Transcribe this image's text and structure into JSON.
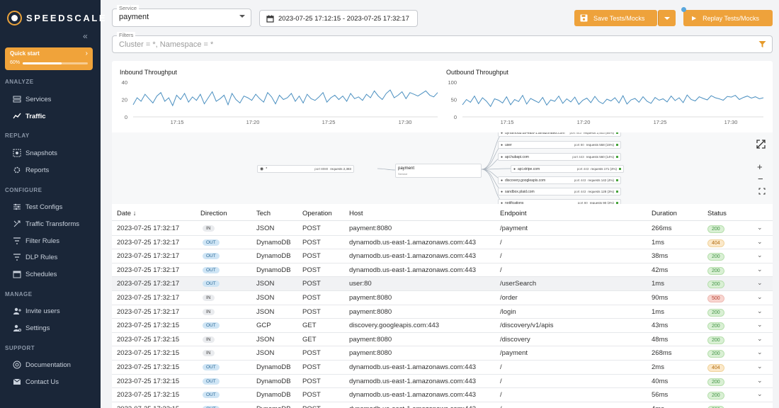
{
  "brand": {
    "name": "SPEEDSCALE"
  },
  "quick_start": {
    "label": "Quick start",
    "percent_text": "60%",
    "progress": 0.6
  },
  "sidebar": {
    "sections": [
      {
        "title": "ANALYZE",
        "items": [
          {
            "label": "Services",
            "icon": "services-icon"
          },
          {
            "label": "Traffic",
            "icon": "traffic-icon",
            "active": true
          }
        ]
      },
      {
        "title": "REPLAY",
        "items": [
          {
            "label": "Snapshots",
            "icon": "snapshots-icon"
          },
          {
            "label": "Reports",
            "icon": "reports-icon"
          }
        ]
      },
      {
        "title": "CONFIGURE",
        "items": [
          {
            "label": "Test Configs",
            "icon": "test-configs-icon"
          },
          {
            "label": "Traffic Transforms",
            "icon": "transforms-icon"
          },
          {
            "label": "Filter Rules",
            "icon": "filter-icon"
          },
          {
            "label": "DLP Rules",
            "icon": "dlp-icon"
          },
          {
            "label": "Schedules",
            "icon": "calendar-icon"
          }
        ]
      },
      {
        "title": "MANAGE",
        "items": [
          {
            "label": "Invite users",
            "icon": "invite-users-icon"
          },
          {
            "label": "Settings",
            "icon": "settings-icon"
          }
        ]
      },
      {
        "title": "SUPPORT",
        "items": [
          {
            "label": "Documentation",
            "icon": "documentation-icon"
          },
          {
            "label": "Contact Us",
            "icon": "contact-icon"
          }
        ]
      }
    ]
  },
  "toolbar": {
    "service_label": "Service",
    "service_value": "payment",
    "date_range": "2023-07-25 17:12:15 - 2023-07-25 17:32:17",
    "save_label": "Save Tests/Mocks",
    "replay_label": "Replay Tests/Mocks"
  },
  "filters": {
    "label": "Filters",
    "placeholder": "Cluster = *, Namespace = *"
  },
  "charts": {
    "inbound": {
      "title": "Inbound Throughput",
      "yticks": [
        "40",
        "20",
        "0"
      ],
      "xticks": [
        "17:15",
        "17:20",
        "17:25",
        "17:30"
      ]
    },
    "outbound": {
      "title": "Outbound Throughput",
      "yticks": [
        "100",
        "50",
        "0"
      ],
      "xticks": [
        "17:15",
        "17:20",
        "17:25",
        "17:30"
      ]
    }
  },
  "chart_data": [
    {
      "type": "line",
      "title": "Inbound Throughput",
      "ylim": [
        0,
        40
      ],
      "xlim": [
        "17:12",
        "17:32"
      ],
      "series": [
        {
          "values": [
            14,
            22,
            18,
            26,
            21,
            16,
            24,
            28,
            18,
            22,
            13,
            25,
            20,
            27,
            17,
            23,
            19,
            26,
            15,
            22,
            29,
            18,
            21,
            25,
            14,
            27,
            20,
            16,
            24,
            22,
            19,
            26,
            21,
            17,
            28,
            23,
            15,
            25,
            20,
            22,
            27,
            18,
            24,
            16,
            26,
            21,
            19,
            23,
            28,
            17,
            22,
            25,
            20,
            24,
            18,
            27,
            21,
            23,
            19,
            26,
            22,
            30,
            24,
            20,
            27,
            31,
            22,
            25,
            29,
            21,
            28,
            26,
            24,
            27,
            30,
            25,
            23,
            28
          ]
        }
      ]
    },
    {
      "type": "line",
      "title": "Outbound Throughput",
      "ylim": [
        0,
        100
      ],
      "xlim": [
        "17:12",
        "17:32"
      ],
      "series": [
        {
          "values": [
            35,
            50,
            42,
            60,
            38,
            55,
            45,
            30,
            52,
            48,
            40,
            58,
            35,
            50,
            44,
            62,
            37,
            53,
            47,
            41,
            56,
            34,
            49,
            45,
            60,
            39,
            52,
            43,
            57,
            36,
            48,
            54,
            41,
            59,
            44,
            38,
            51,
            46,
            55,
            40,
            61,
            37,
            49,
            53,
            42,
            58,
            45,
            39,
            56,
            48,
            52,
            43,
            60,
            47,
            55,
            41,
            63,
            50,
            46,
            58,
            53,
            49,
            61,
            55,
            52,
            48,
            59,
            57,
            62,
            50,
            56,
            60,
            54,
            58,
            52,
            55
          ]
        }
      ]
    }
  ],
  "graph": {
    "source": {
      "name": "*",
      "port_text": "port 8080",
      "requests_text": "requests 2,383"
    },
    "service": {
      "name": "payment",
      "sub": "Service"
    },
    "targets": [
      {
        "name": "dynamodb.us-east-1.amazonaws.com",
        "port": "443",
        "req": "2,403 (84%)"
      },
      {
        "name": "user",
        "port": "80",
        "req": "558 (15%)"
      },
      {
        "name": "api.hubapi.com",
        "port": "443",
        "req": "560 (14%)"
      },
      {
        "name": "api.stripe.com",
        "port": "443",
        "req": "171 (4%)"
      },
      {
        "name": "discovery.googleapis.com",
        "port": "443",
        "req": "142 (4%)"
      },
      {
        "name": "sandbox.plaid.com",
        "port": "443",
        "req": "128 (3%)"
      },
      {
        "name": "notifications",
        "port": "80",
        "req": "90 (2%)"
      }
    ]
  },
  "table": {
    "columns": [
      "Date",
      "Direction",
      "Tech",
      "Operation",
      "Host",
      "Endpoint",
      "Duration",
      "Status"
    ],
    "rows": [
      {
        "date": "2023-07-25 17:32:17",
        "dir": "IN",
        "tech": "JSON",
        "op": "POST",
        "host": "payment:8080",
        "endpoint": "/payment",
        "duration": "266ms",
        "status": "200"
      },
      {
        "date": "2023-07-25 17:32:17",
        "dir": "OUT",
        "tech": "DynamoDB",
        "op": "POST",
        "host": "dynamodb.us-east-1.amazonaws.com:443",
        "endpoint": "/",
        "duration": "1ms",
        "status": "404"
      },
      {
        "date": "2023-07-25 17:32:17",
        "dir": "OUT",
        "tech": "DynamoDB",
        "op": "POST",
        "host": "dynamodb.us-east-1.amazonaws.com:443",
        "endpoint": "/",
        "duration": "38ms",
        "status": "200"
      },
      {
        "date": "2023-07-25 17:32:17",
        "dir": "OUT",
        "tech": "DynamoDB",
        "op": "POST",
        "host": "dynamodb.us-east-1.amazonaws.com:443",
        "endpoint": "/",
        "duration": "42ms",
        "status": "200"
      },
      {
        "date": "2023-07-25 17:32:17",
        "dir": "OUT",
        "tech": "JSON",
        "op": "POST",
        "host": "user:80",
        "endpoint": "/userSearch",
        "duration": "1ms",
        "status": "200",
        "highlight": true
      },
      {
        "date": "2023-07-25 17:32:17",
        "dir": "IN",
        "tech": "JSON",
        "op": "POST",
        "host": "payment:8080",
        "endpoint": "/order",
        "duration": "90ms",
        "status": "500"
      },
      {
        "date": "2023-07-25 17:32:17",
        "dir": "IN",
        "tech": "JSON",
        "op": "POST",
        "host": "payment:8080",
        "endpoint": "/login",
        "duration": "1ms",
        "status": "200"
      },
      {
        "date": "2023-07-25 17:32:15",
        "dir": "OUT",
        "tech": "GCP",
        "op": "GET",
        "host": "discovery.googleapis.com:443",
        "endpoint": "/discovery/v1/apis",
        "duration": "43ms",
        "status": "200"
      },
      {
        "date": "2023-07-25 17:32:15",
        "dir": "IN",
        "tech": "JSON",
        "op": "GET",
        "host": "payment:8080",
        "endpoint": "/discovery",
        "duration": "48ms",
        "status": "200"
      },
      {
        "date": "2023-07-25 17:32:15",
        "dir": "IN",
        "tech": "JSON",
        "op": "POST",
        "host": "payment:8080",
        "endpoint": "/payment",
        "duration": "268ms",
        "status": "200"
      },
      {
        "date": "2023-07-25 17:32:15",
        "dir": "OUT",
        "tech": "DynamoDB",
        "op": "POST",
        "host": "dynamodb.us-east-1.amazonaws.com:443",
        "endpoint": "/",
        "duration": "2ms",
        "status": "404"
      },
      {
        "date": "2023-07-25 17:32:15",
        "dir": "OUT",
        "tech": "DynamoDB",
        "op": "POST",
        "host": "dynamodb.us-east-1.amazonaws.com:443",
        "endpoint": "/",
        "duration": "40ms",
        "status": "200"
      },
      {
        "date": "2023-07-25 17:32:15",
        "dir": "OUT",
        "tech": "DynamoDB",
        "op": "POST",
        "host": "dynamodb.us-east-1.amazonaws.com:443",
        "endpoint": "/",
        "duration": "56ms",
        "status": "200"
      },
      {
        "date": "2023-07-25 17:32:15",
        "dir": "OUT",
        "tech": "DynamoDB",
        "op": "POST",
        "host": "dynamodb.us-east-1.amazonaws.com:443",
        "endpoint": "/",
        "duration": "4ms",
        "status": "200"
      }
    ]
  },
  "colors": {
    "accent": "#eea23b",
    "sidebar_bg": "#1a2638",
    "line": "#4a8fc0",
    "status_200": "#3f9142",
    "status_404": "#c07a16",
    "status_500": "#c0392b"
  }
}
